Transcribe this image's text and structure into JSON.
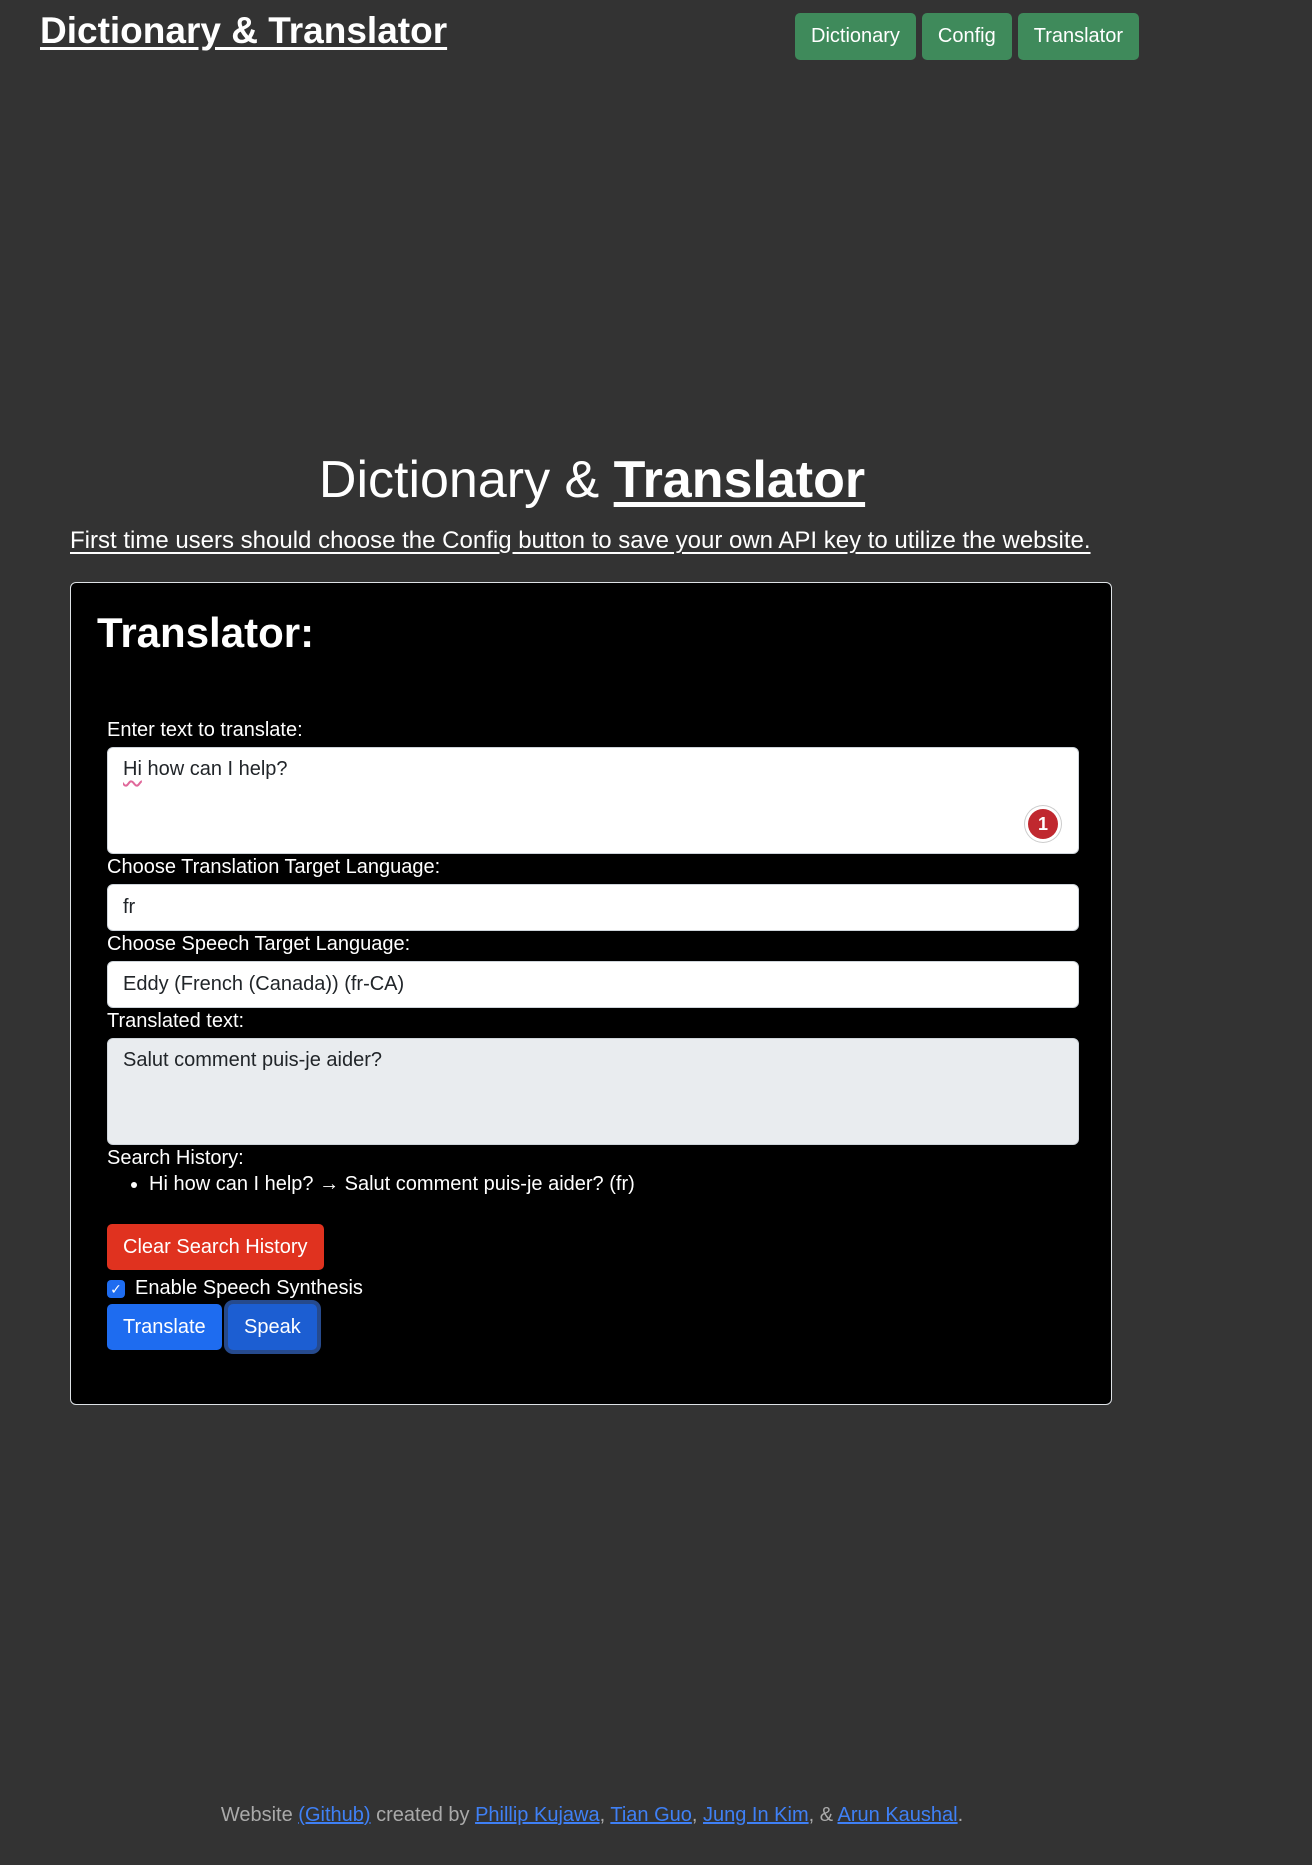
{
  "header": {
    "brand": "Dictionary & Translator",
    "nav": [
      "Dictionary",
      "Config",
      "Translator"
    ]
  },
  "hero": {
    "title_plain": "Dictionary & ",
    "title_underlined": "Translator",
    "notice": "First time users should choose the Config button to save your own API key to utilize the website."
  },
  "translator": {
    "title": "Translator:",
    "input_label": "Enter text to translate:",
    "input_text_flagged": "Hi",
    "input_text_rest": " how can I help?",
    "grammar_badge_count": "1",
    "target_label": "Choose Translation Target Language:",
    "target_value": "fr",
    "speech_label": "Choose Speech Target Language:",
    "speech_value": "Eddy (French (Canada)) (fr-CA)",
    "output_label": "Translated text:",
    "output_value": "Salut comment puis-je aider?",
    "history_label": "Search History:",
    "history": [
      "Hi how can I help? → Salut comment puis-je aider? (fr)"
    ],
    "clear_history_label": "Clear Search History",
    "speech_checkbox_label": "Enable Speech Synthesis",
    "speech_enabled": true,
    "translate_label": "Translate",
    "speak_label": "Speak"
  },
  "footer": {
    "prefix": "Website ",
    "github": "(Github)",
    "created_by": " created by ",
    "author1": "Phillip Kujawa",
    "sep1": ", ",
    "author2": "Tian Guo",
    "sep2": ", ",
    "author3": "Jung In Kim",
    "sep3": ", & ",
    "author4": "Arun Kaushal",
    "suffix": "."
  },
  "colors": {
    "background": "#333333",
    "nav_green": "#3f8a5b",
    "primary_blue": "#1e6cf0",
    "danger_red": "#e0321f"
  }
}
